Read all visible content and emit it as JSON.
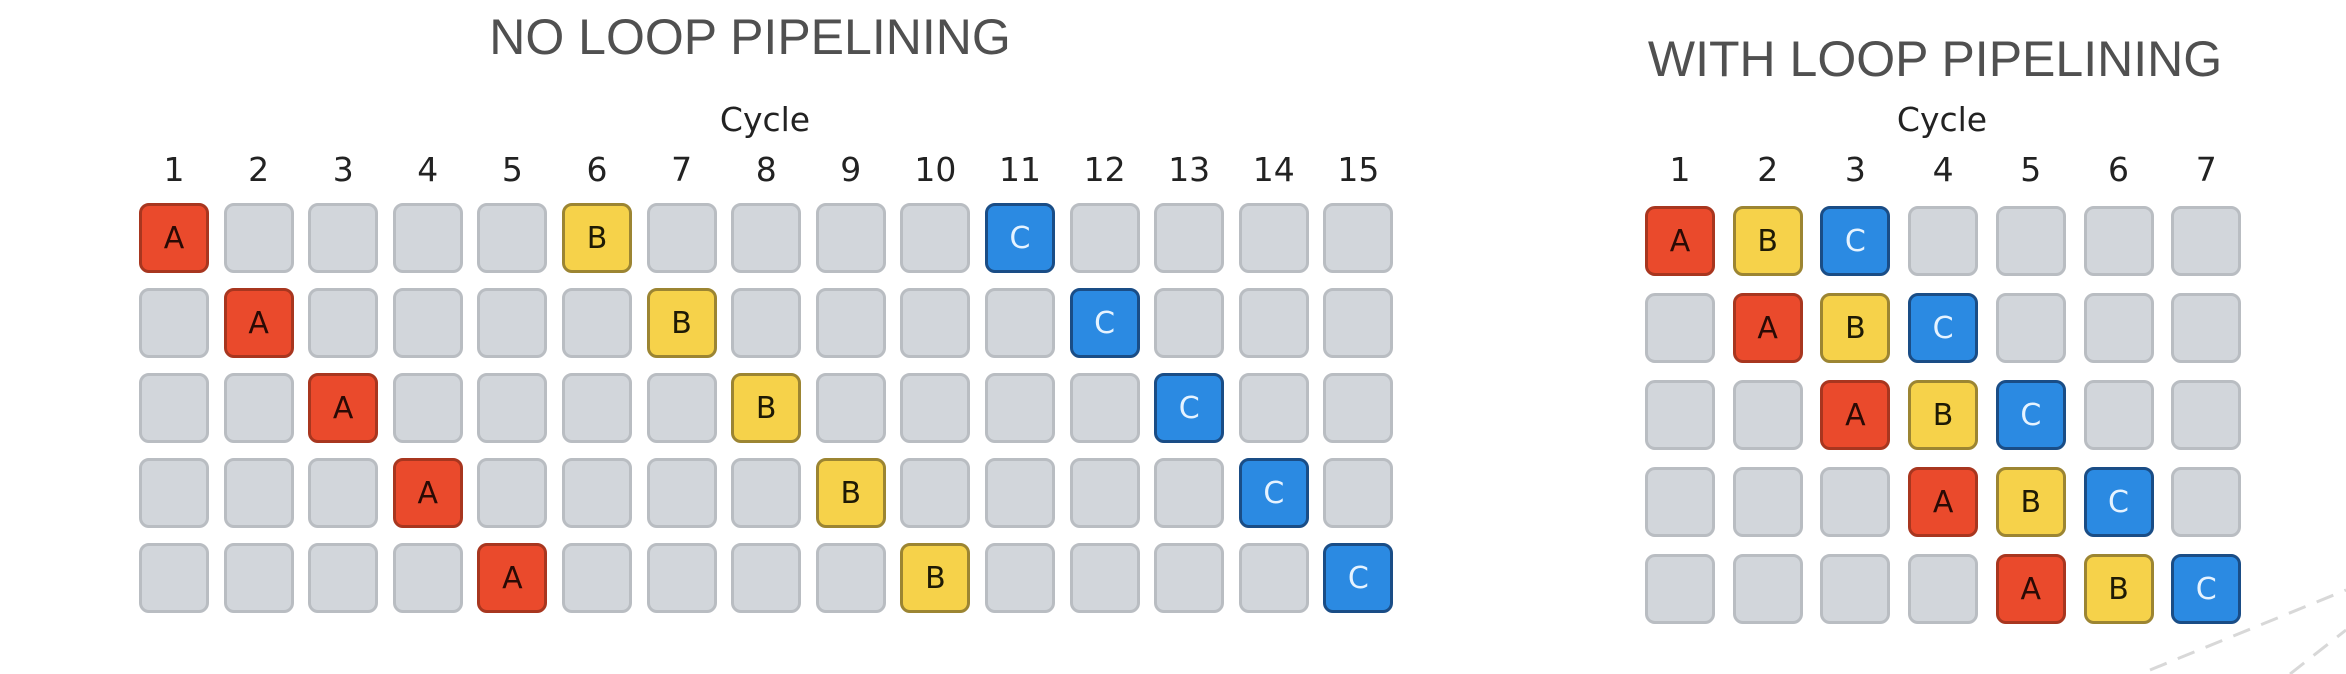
{
  "diagrams": [
    {
      "title": "NO LOOP PIPELINING",
      "axis_label": "Cycle",
      "cycles": [
        "1",
        "2",
        "3",
        "4",
        "5",
        "6",
        "7",
        "8",
        "9",
        "10",
        "11",
        "12",
        "13",
        "14",
        "15"
      ],
      "rows": [
        {
          "A": 1,
          "B": 6,
          "C": 11
        },
        {
          "A": 2,
          "B": 7,
          "C": 12
        },
        {
          "A": 3,
          "B": 8,
          "C": 13
        },
        {
          "A": 4,
          "B": 9,
          "C": 14
        },
        {
          "A": 5,
          "B": 10,
          "C": 15
        }
      ]
    },
    {
      "title": "WITH LOOP PIPELINING",
      "axis_label": "Cycle",
      "cycles": [
        "1",
        "2",
        "3",
        "4",
        "5",
        "6",
        "7"
      ],
      "rows": [
        {
          "A": 1,
          "B": 2,
          "C": 3
        },
        {
          "A": 2,
          "B": 3,
          "C": 4
        },
        {
          "A": 3,
          "B": 4,
          "C": 5
        },
        {
          "A": 4,
          "B": 5,
          "C": 6
        },
        {
          "A": 5,
          "B": 6,
          "C": 7
        }
      ]
    }
  ],
  "stage_labels": [
    "A",
    "B",
    "C"
  ],
  "colors": {
    "A": "#ea4a2c",
    "B": "#f6d24a",
    "C": "#2b8ae2",
    "empty": "#d2d6db"
  }
}
